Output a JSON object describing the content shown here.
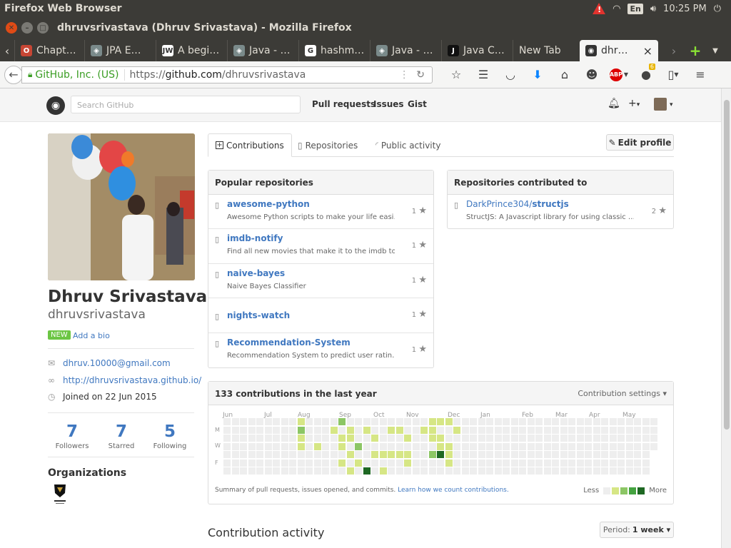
{
  "os": {
    "app_title": "Firefox Web Browser",
    "keyboard": "En",
    "time": "10:25 PM"
  },
  "window": {
    "title": "dhruvsrivastava (Dhruv Srivastava) - Mozilla Firefox"
  },
  "tabs": [
    {
      "label": "Chapt…",
      "icon": "oracle-icon",
      "color": "#c74634",
      "glyph": "O"
    },
    {
      "label": "JPA E…",
      "icon": "site-icon",
      "color": "#7a8a8a",
      "glyph": "◈"
    },
    {
      "label": "A begi…",
      "icon": "javaworld-icon",
      "color": "#ffffff",
      "glyph": "JW"
    },
    {
      "label": "Java - …",
      "icon": "site-icon",
      "color": "#7a8a8a",
      "glyph": "◈"
    },
    {
      "label": "hashm…",
      "icon": "google-icon",
      "color": "#ffffff",
      "glyph": "G"
    },
    {
      "label": "Java - …",
      "icon": "site-icon",
      "color": "#7a8a8a",
      "glyph": "◈"
    },
    {
      "label": "Java C…",
      "icon": "j-icon",
      "color": "#111111",
      "glyph": "J"
    },
    {
      "label": "New Tab",
      "icon": "",
      "color": "",
      "glyph": ""
    },
    {
      "label": "dhr…",
      "icon": "github-icon",
      "color": "#333333",
      "glyph": "◉"
    }
  ],
  "nav": {
    "site_identity": "GitHub, Inc. (US)",
    "url_prefix": "https://",
    "url_host": "github.com",
    "url_path": "/dhruvsrivastava",
    "addon_badge": "6"
  },
  "github": {
    "search_placeholder": "Search GitHub",
    "nav": [
      "Pull requests",
      "Issues",
      "Gist"
    ]
  },
  "profile": {
    "name": "Dhruv Srivastava",
    "username": "dhruvsrivastava",
    "new_badge": "NEW",
    "add_bio": "Add a bio",
    "email": "dhruv.10000@gmail.com",
    "website": "http://dhruvsrivastava.github.io/",
    "joined": "Joined on 22 Jun 2015",
    "stats": [
      {
        "value": "7",
        "label": "Followers"
      },
      {
        "value": "7",
        "label": "Starred"
      },
      {
        "value": "5",
        "label": "Following"
      }
    ],
    "organizations_heading": "Organizations"
  },
  "profile_tabs": [
    "Contributions",
    "Repositories",
    "Public activity"
  ],
  "edit_profile": "Edit profile",
  "popular": {
    "heading": "Popular repositories",
    "repos": [
      {
        "name": "awesome-python",
        "desc": "Awesome Python scripts to make your life easi…",
        "stars": "1"
      },
      {
        "name": "imdb-notify",
        "desc": "Find all new movies that make it to the imdb to…",
        "stars": "1"
      },
      {
        "name": "naive-bayes",
        "desc": "Naive Bayes Classifier",
        "stars": "1"
      },
      {
        "name": "nights-watch",
        "desc": "",
        "stars": "1"
      },
      {
        "name": "Recommendation-System",
        "desc": "Recommendation System to predict user ratin…",
        "stars": "1"
      }
    ]
  },
  "contributed": {
    "heading": "Repositories contributed to",
    "repos": [
      {
        "owner": "DarkPrince304/",
        "name": "structjs",
        "desc": "StructJS: A Javascript library for using classic …",
        "stars": "2"
      }
    ]
  },
  "contributions": {
    "heading": "133 contributions in the last year",
    "settings": "Contribution settings ▾",
    "months": [
      "Jun",
      "Jul",
      "Aug",
      "Sep",
      "Oct",
      "Nov",
      "Dec",
      "Jan",
      "Feb",
      "Mar",
      "Apr",
      "May"
    ],
    "day_labels": [
      "M",
      "W",
      "F"
    ],
    "summary": "Summary of pull requests, issues opened, and commits.",
    "learn_link": "Learn how we count contributions.",
    "legend_less": "Less",
    "legend_more": "More",
    "colors": [
      "#eeeeee",
      "#d6e685",
      "#8cc665",
      "#44a340",
      "#1e6823"
    ],
    "active_cells": [
      [
        17,
        6,
        4
      ],
      [
        17,
        7,
        4
      ],
      [
        17,
        8,
        4
      ],
      [
        14,
        0,
        2
      ],
      [
        13,
        1,
        1
      ],
      [
        15,
        1,
        1
      ],
      [
        15,
        2,
        1
      ],
      [
        16,
        3,
        2
      ],
      [
        14,
        3,
        1
      ],
      [
        15,
        4,
        1
      ],
      [
        16,
        5,
        1
      ],
      [
        15,
        6,
        1
      ],
      [
        17,
        1,
        1
      ],
      [
        22,
        2,
        1
      ],
      [
        20,
        1,
        1
      ],
      [
        21,
        1,
        1
      ],
      [
        25,
        2,
        1
      ],
      [
        26,
        2,
        1
      ],
      [
        26,
        3,
        1
      ],
      [
        27,
        3,
        1
      ],
      [
        25,
        1,
        1
      ],
      [
        25,
        0,
        1
      ],
      [
        26,
        0,
        1
      ],
      [
        27,
        0,
        1
      ],
      [
        26,
        4,
        4
      ],
      [
        25,
        4,
        2
      ],
      [
        21,
        4,
        1
      ],
      [
        22,
        4,
        1
      ],
      [
        22,
        5,
        1
      ],
      [
        20,
        4,
        1
      ],
      [
        19,
        4,
        1
      ],
      [
        18,
        4,
        1
      ],
      [
        24,
        1,
        1
      ],
      [
        28,
        1,
        1
      ],
      [
        27,
        5,
        1
      ],
      [
        9,
        0,
        1
      ],
      [
        9,
        1,
        2
      ],
      [
        9,
        2,
        1
      ],
      [
        9,
        3,
        1
      ],
      [
        11,
        3,
        1
      ],
      [
        14,
        5,
        1
      ],
      [
        14,
        2,
        1
      ],
      [
        27,
        4,
        1
      ],
      [
        18,
        2,
        1
      ],
      [
        19,
        6,
        1
      ]
    ]
  },
  "activity": {
    "heading": "Contribution activity",
    "period_label": "Period:",
    "period_value": "1 week ▾"
  }
}
